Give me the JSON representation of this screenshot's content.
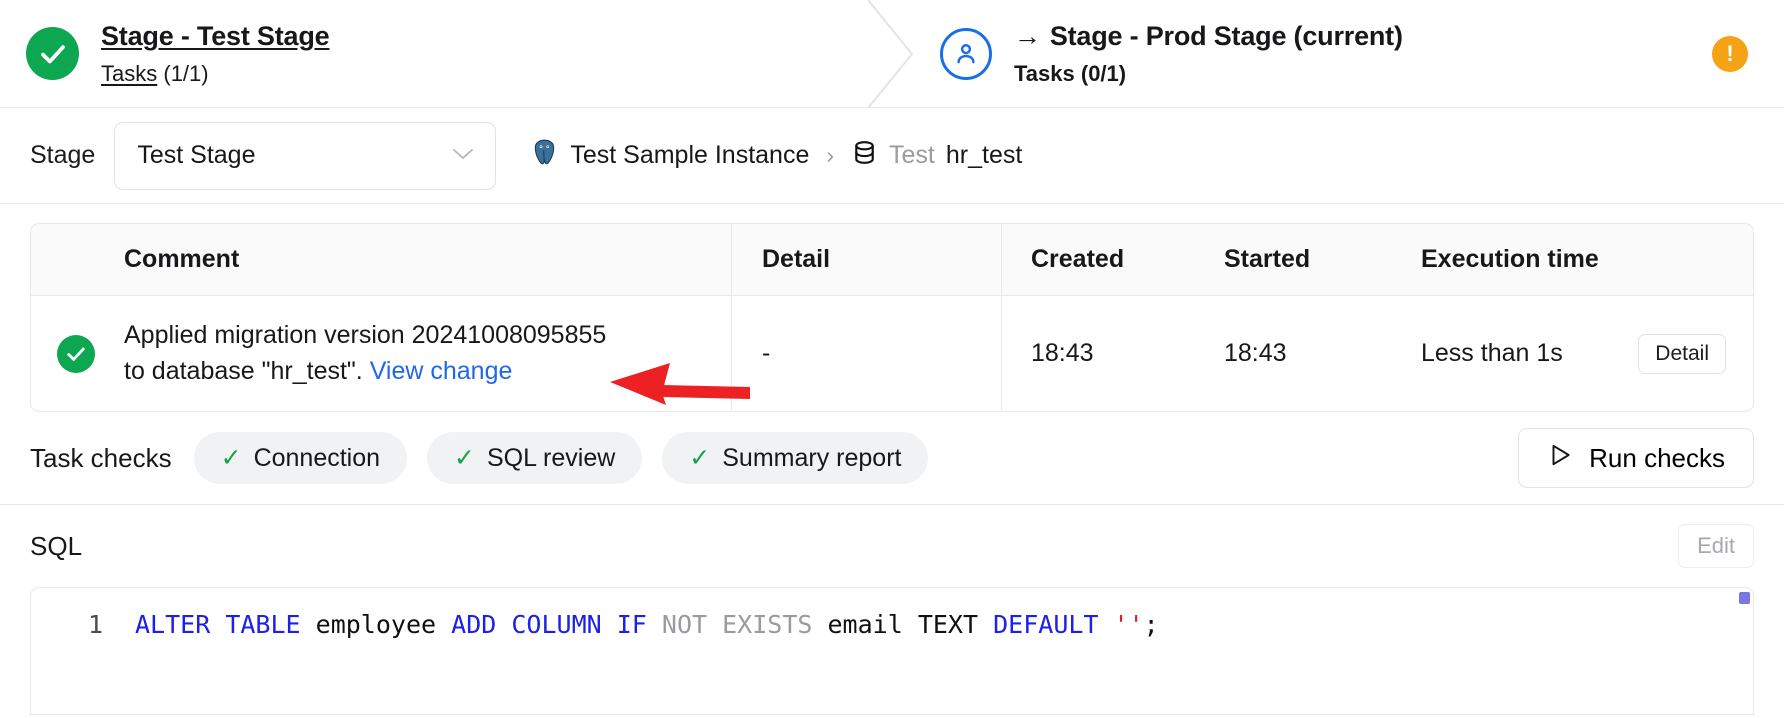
{
  "stage_header": {
    "left": {
      "status_icon": "check-circle-icon",
      "title": "Stage - Test Stage",
      "tasks_label": "Tasks",
      "tasks_count": "(1/1)"
    },
    "right": {
      "status_icon": "user-circle-icon",
      "arrow": "→",
      "title": "Stage - Prod Stage (current)",
      "tasks_label": "Tasks",
      "tasks_count": "(0/1)"
    },
    "warning_badge": "!"
  },
  "toolbar": {
    "stage_label": "Stage",
    "stage_select_value": "Test Stage",
    "chevron": "⌄",
    "breadcrumb": {
      "instance_icon": "postgres-elephant-icon",
      "instance": "Test Sample Instance",
      "separator": "›",
      "database_icon": "database-icon",
      "db_env": "Test",
      "db_name": "hr_test"
    }
  },
  "task_table": {
    "columns": [
      "Comment",
      "Detail",
      "Created",
      "Started",
      "Execution time"
    ],
    "rows": [
      {
        "status_icon": "check-circle-icon",
        "comment_line1": "Applied migration version 20241008095855",
        "comment_line2": "to database \"hr_test\". ",
        "comment_link": "View change",
        "detail": "-",
        "created": "18:43",
        "started": "18:43",
        "execution_time": "Less than 1s",
        "detail_button": "Detail"
      }
    ]
  },
  "task_checks": {
    "label": "Task checks",
    "chips": [
      {
        "tick": "✓",
        "label": "Connection"
      },
      {
        "tick": "✓",
        "label": "SQL review"
      },
      {
        "tick": "✓",
        "label": "Summary report"
      }
    ],
    "run_button": "Run checks",
    "run_icon": "play-triangle-icon"
  },
  "sql_section": {
    "label": "SQL",
    "edit_button": "Edit",
    "line_number": "1",
    "tokens": [
      {
        "t": "ALTER",
        "c": "kw"
      },
      {
        "t": " ",
        "c": "pun"
      },
      {
        "t": "TABLE",
        "c": "kw"
      },
      {
        "t": " ",
        "c": "pun"
      },
      {
        "t": "employee",
        "c": "id"
      },
      {
        "t": " ",
        "c": "pun"
      },
      {
        "t": "ADD",
        "c": "kw"
      },
      {
        "t": " ",
        "c": "pun"
      },
      {
        "t": "COLUMN",
        "c": "kw"
      },
      {
        "t": " ",
        "c": "pun"
      },
      {
        "t": "IF",
        "c": "kw"
      },
      {
        "t": " ",
        "c": "pun"
      },
      {
        "t": "NOT",
        "c": "kw2"
      },
      {
        "t": " ",
        "c": "pun"
      },
      {
        "t": "EXISTS",
        "c": "kw2"
      },
      {
        "t": " ",
        "c": "pun"
      },
      {
        "t": "email",
        "c": "id"
      },
      {
        "t": " ",
        "c": "pun"
      },
      {
        "t": "TEXT",
        "c": "id"
      },
      {
        "t": " ",
        "c": "pun"
      },
      {
        "t": "DEFAULT",
        "c": "kw"
      },
      {
        "t": " ",
        "c": "pun"
      },
      {
        "t": "''",
        "c": "str"
      },
      {
        "t": ";",
        "c": "pun"
      }
    ]
  },
  "colors": {
    "success_green": "#0ca750",
    "link_blue": "#2168e8",
    "warning_orange": "#f5a214",
    "accent_blue": "#1a6fe8",
    "annotation_red": "#ed2024",
    "keyword_blue": "#1c20e8",
    "string_red": "#e02020",
    "scrollbar_purple": "#7a78e0"
  }
}
